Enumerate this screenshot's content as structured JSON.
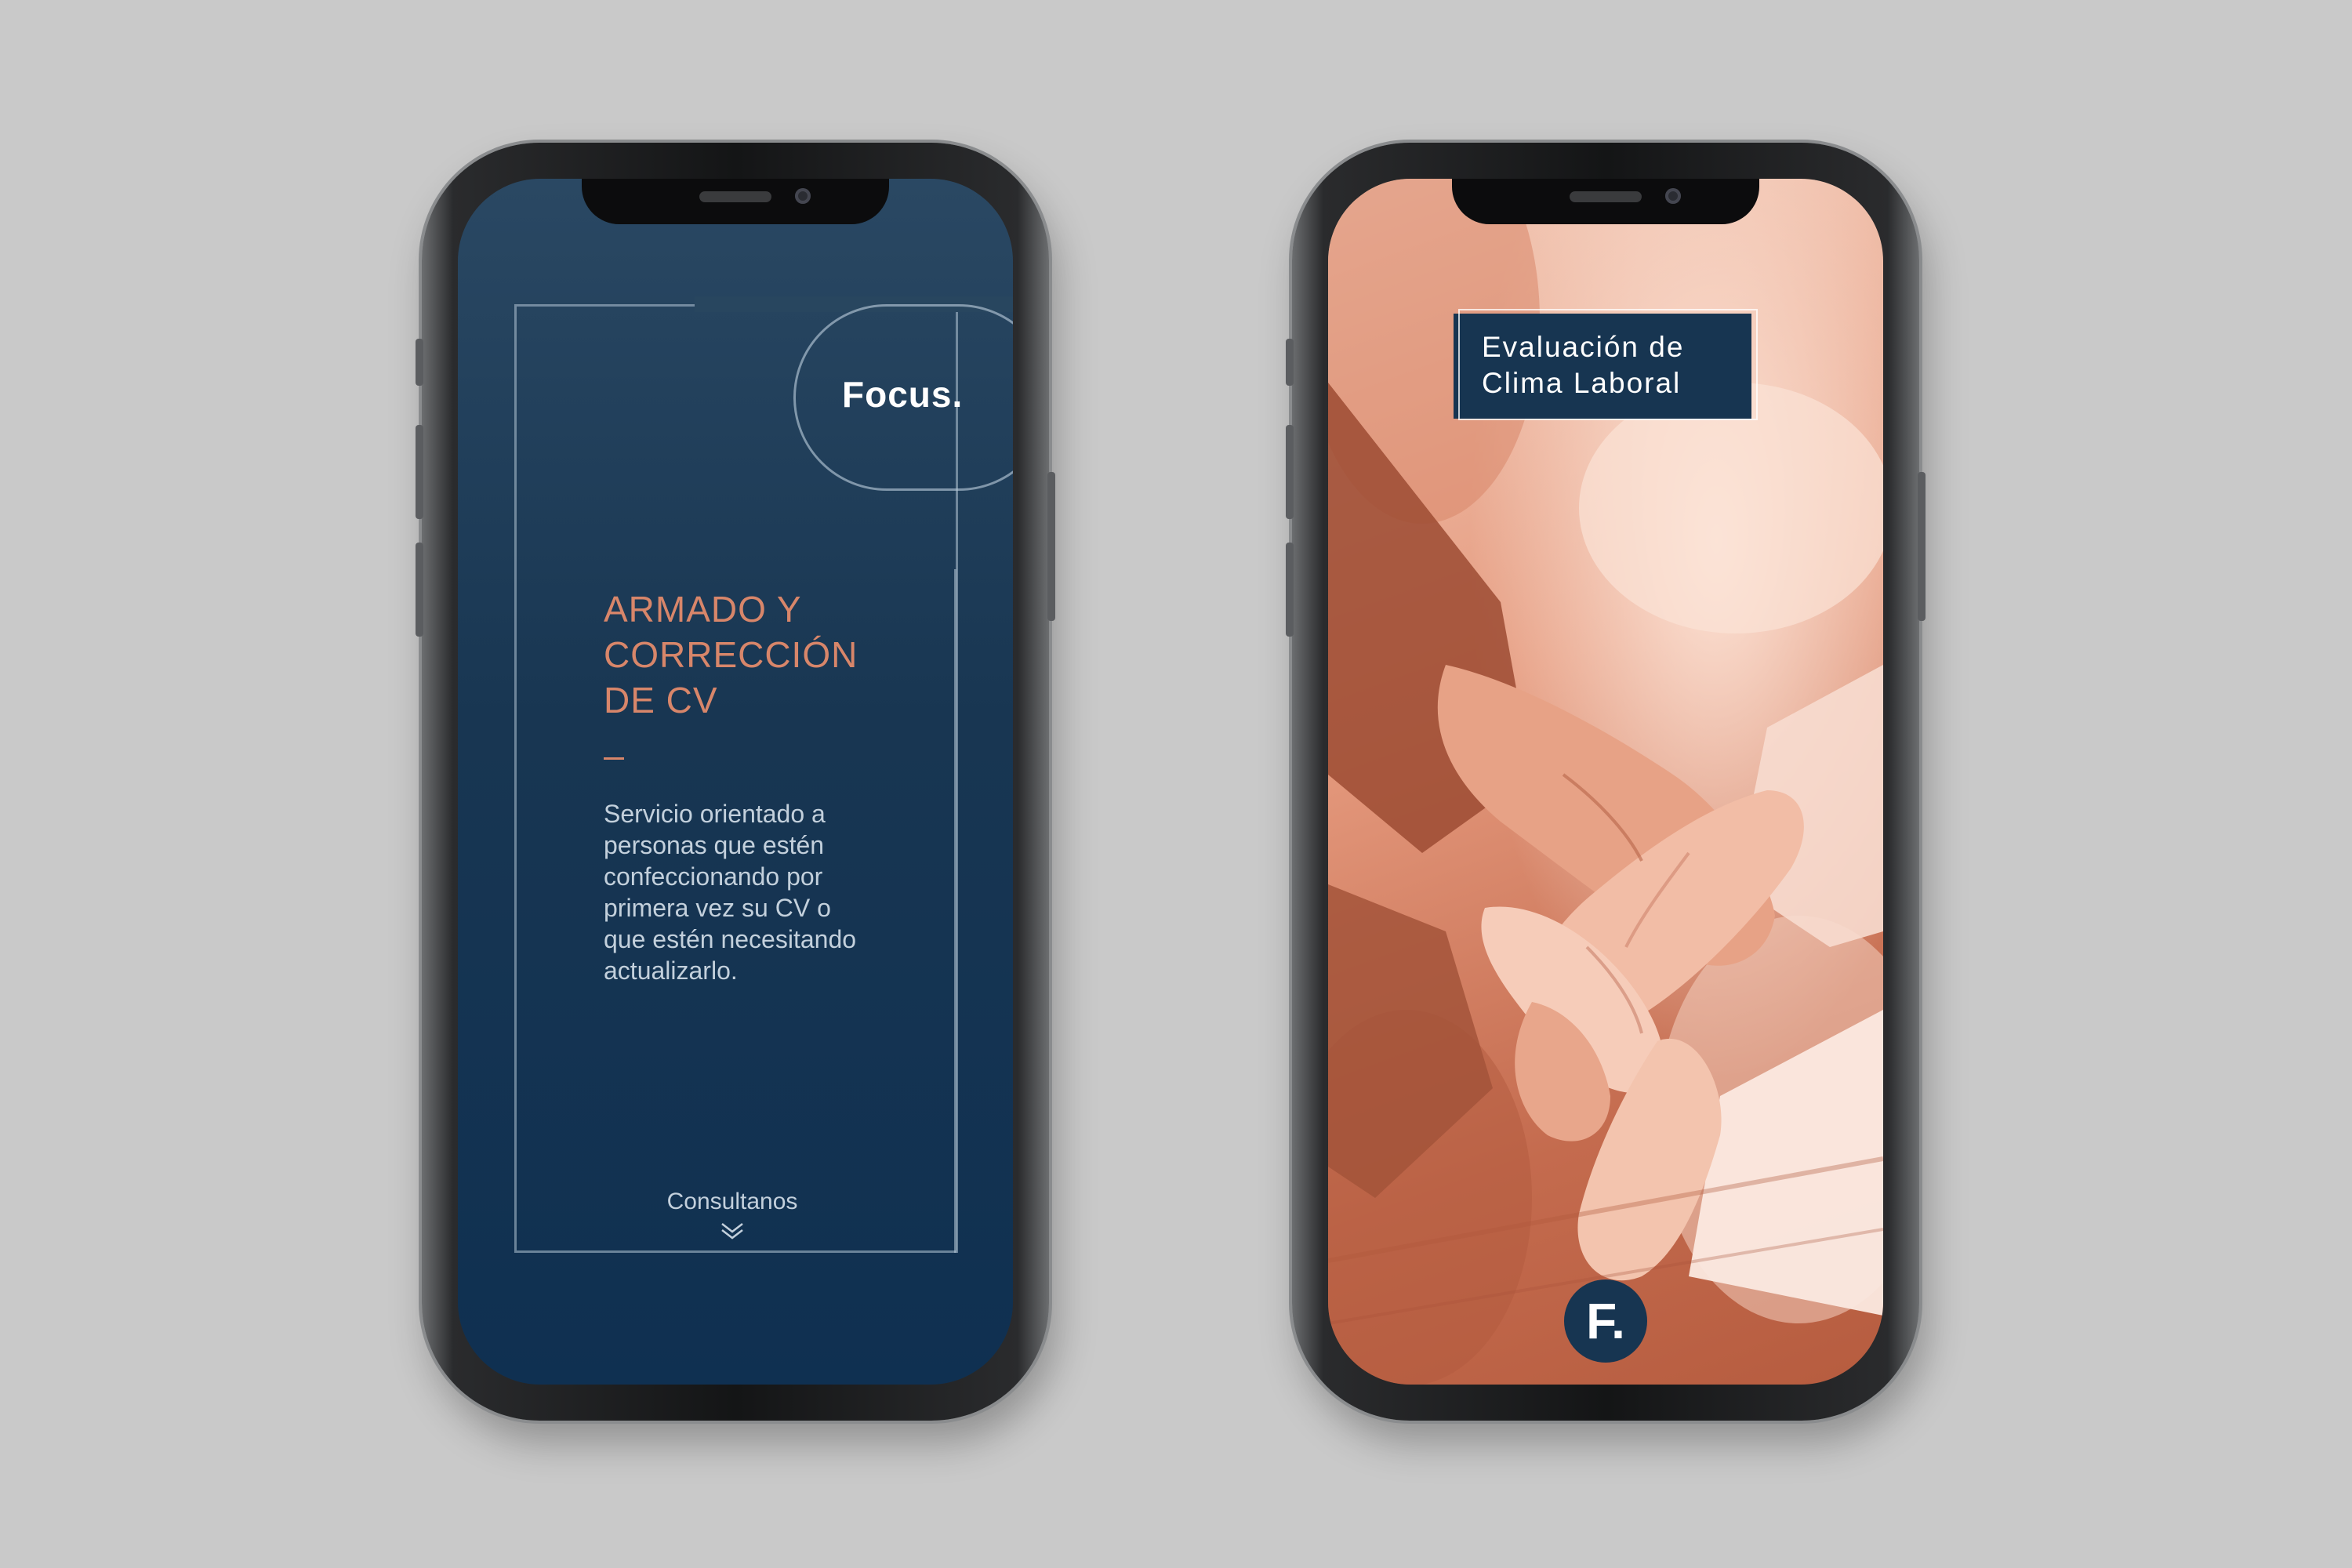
{
  "left_screen": {
    "logo": "Focus.",
    "headline_lines": [
      "ARMADO Y",
      "CORRECCIÓN",
      "DE CV"
    ],
    "body": "Servicio orientado a\npersonas que estén\nconfeccionando por\nprimera vez su CV o\nque estén necesitando\nactualizarlo.",
    "cta_label": "Consultanos",
    "cta_icon": "chevron-double-down-icon"
  },
  "right_screen": {
    "title": "Evaluación de\nClima Laboral",
    "badge": "F."
  },
  "colors": {
    "background": "#c9c9c9",
    "navy": "#173551",
    "accent_salmon": "#d8866a",
    "body_text": "#c3d0dc"
  }
}
